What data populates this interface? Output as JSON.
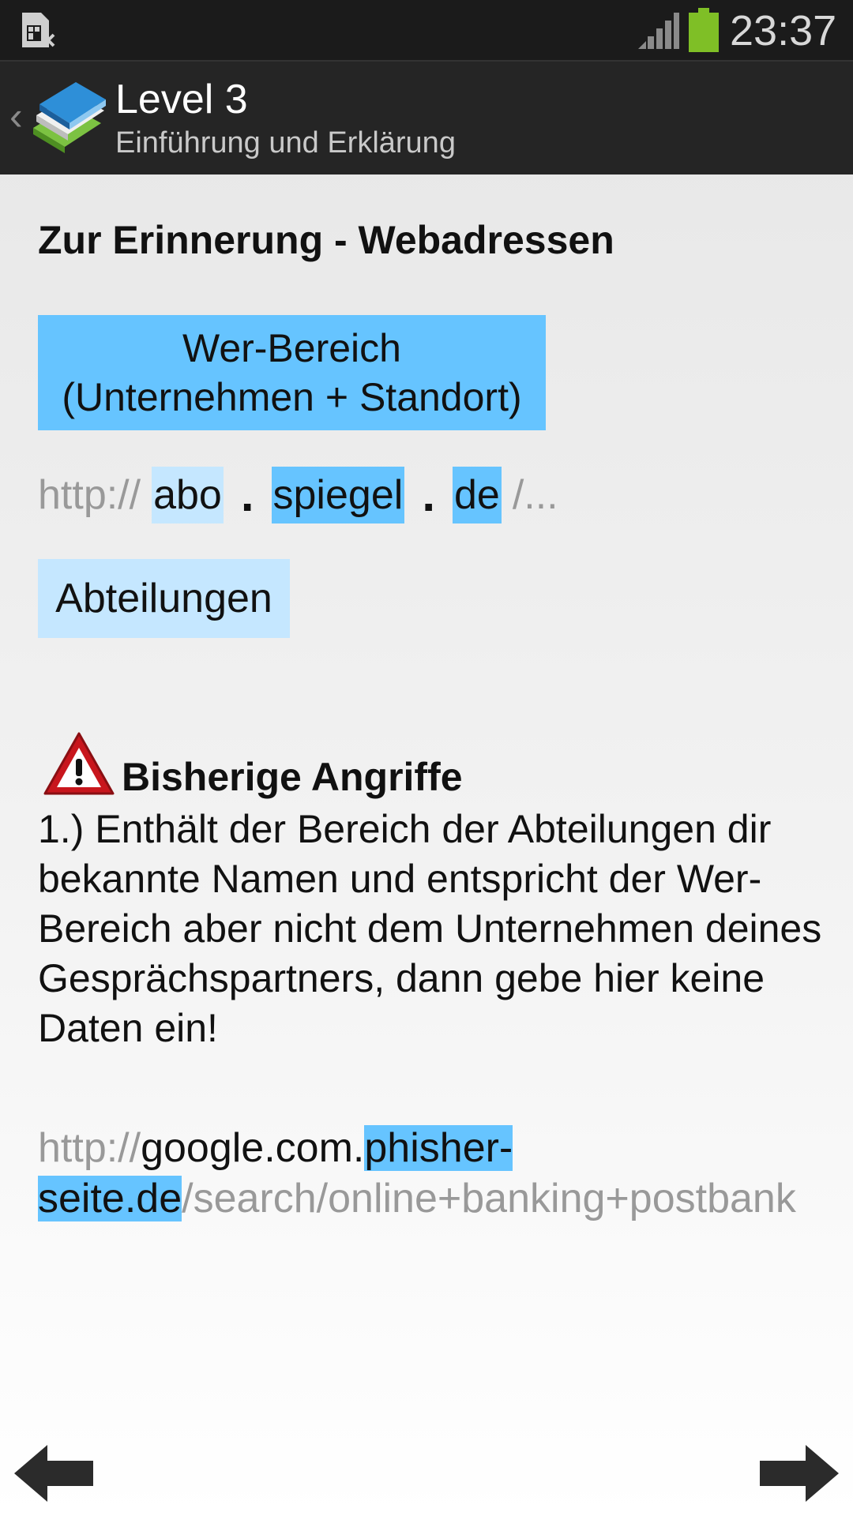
{
  "status_bar": {
    "time": "23:37",
    "icons": [
      "sim-card-icon",
      "signal-icon",
      "battery-icon"
    ],
    "battery_color": "#7fbf26"
  },
  "action_bar": {
    "title": "Level 3",
    "subtitle": "Einführung und Erklärung",
    "back_glyph": "‹"
  },
  "content": {
    "heading": "Zur Erinnerung - Webadressen",
    "wer_box": {
      "line1": "Wer-Bereich",
      "line2": "(Unternehmen + Standort)"
    },
    "url_example": {
      "prefix": "http://",
      "part1": "abo",
      "dot1": ".",
      "part2": "spiegel",
      "dot2": ".",
      "part3": "de",
      "suffix": "/..."
    },
    "abteilungen_label": "Abteilungen",
    "warning_title": "Bisherige Angriffe",
    "paragraph": "1.) Enthält der Bereich der Abteilungen dir bekannte Namen und entspricht der Wer-Bereich aber nicht dem Unternehmen deines Gesprächspartners, dann gebe hier keine Daten ein!",
    "phish_url": {
      "prefix": "http://",
      "host_start": "google.com.",
      "highlight": "phisher-seite.de",
      "rest": "/search/online+banking+postbank"
    }
  },
  "colors": {
    "highlight_dark": "#66c4ff",
    "highlight_light": "#c5e7ff",
    "action_bar_bg": "#252525"
  },
  "navigation": {
    "prev": "arrow-left-icon",
    "next": "arrow-right-icon"
  }
}
